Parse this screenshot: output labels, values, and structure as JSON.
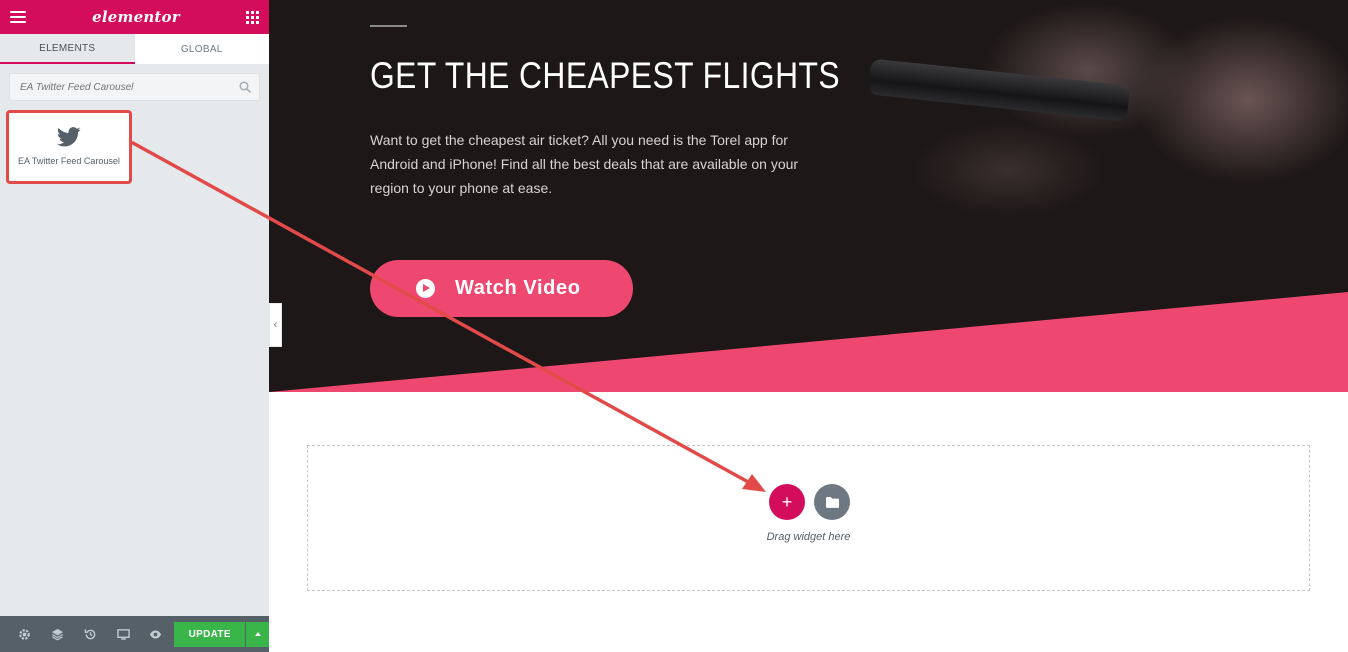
{
  "editor": {
    "brand": "elementor",
    "tabs": [
      {
        "label": "ELEMENTS",
        "active": true
      },
      {
        "label": "GLOBAL",
        "active": false
      }
    ],
    "search": {
      "placeholder": "EA Twitter Feed Carousel"
    },
    "widget": {
      "label": "EA Twitter Feed Carousel",
      "icon": "twitter-icon"
    },
    "footer": {
      "icons": [
        "settings-icon",
        "layers-icon",
        "history-icon",
        "responsive-icon",
        "preview-icon"
      ],
      "update_label": "UPDATE"
    }
  },
  "hero": {
    "title": "GET THE CHEAPEST FLIGHTS",
    "description": "Want to get the cheapest air ticket? All you need is the Torel app for Android and iPhone! Find all the best deals that are available on your region to your phone at ease.",
    "button_label": "Watch Video"
  },
  "dropzone": {
    "label": "Drag widget here"
  },
  "colors": {
    "brand": "#d30c5c",
    "accent_pink": "#ee4870",
    "update_green": "#39b54a",
    "sidebar_bg": "#e6e9ec",
    "annotation_red": "#e24a4a"
  }
}
